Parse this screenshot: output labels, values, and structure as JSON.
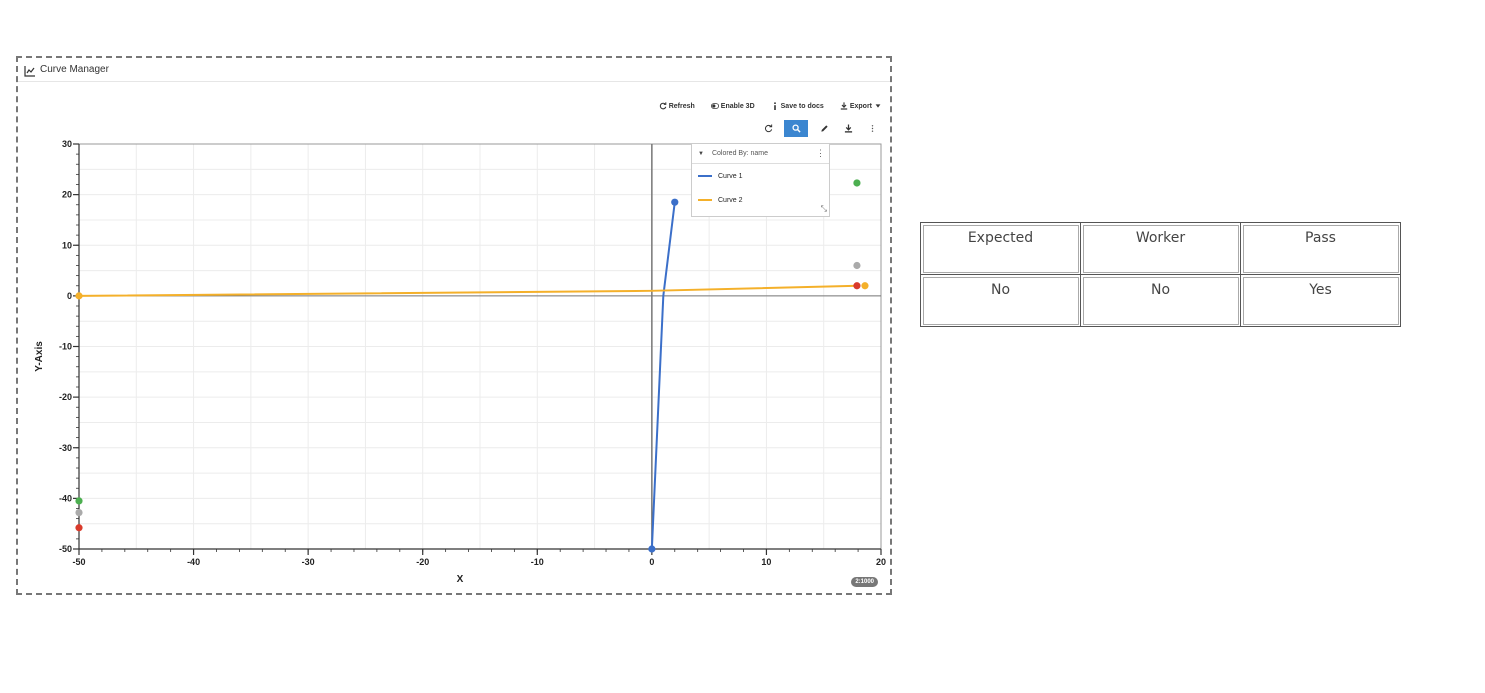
{
  "panel": {
    "title": "Curve Manager"
  },
  "toolbar": {
    "refresh_label": "Refresh",
    "enable3d_label": "Enable 3D",
    "save_label": "Save to docs",
    "export_label": "Export"
  },
  "legend": {
    "header": "Colored By: name",
    "items": [
      {
        "label": "Curve 1",
        "color": "#3b6fc9"
      },
      {
        "label": "Curve 2",
        "color": "#f4b02a"
      }
    ]
  },
  "zoom_badge": "2:1000",
  "chart_data": {
    "type": "line",
    "xlabel": "X",
    "ylabel": "Y-Axis",
    "xlim": [
      -50,
      20
    ],
    "ylim": [
      -50,
      30
    ],
    "xticks": [
      -50,
      -40,
      -30,
      -20,
      -10,
      0,
      10,
      20
    ],
    "yticks": [
      30,
      20,
      10,
      0,
      -10,
      -20,
      -30,
      -40,
      -50
    ],
    "grid": true,
    "legend_position": "top-right",
    "series": [
      {
        "name": "Curve 1",
        "color": "#3b6fc9",
        "x": [
          0,
          1,
          2
        ],
        "y": [
          -50,
          0,
          18.5
        ]
      },
      {
        "name": "Curve 2",
        "color": "#f4b02a",
        "x": [
          -50,
          0,
          18
        ],
        "y": [
          0,
          1,
          2
        ]
      }
    ],
    "markers": [
      {
        "x": 2,
        "y": 18.5,
        "color": "#3b6fc9"
      },
      {
        "x": 0,
        "y": -50,
        "color": "#3b6fc9"
      },
      {
        "x": -50,
        "y": 0,
        "color": "#f4b02a"
      },
      {
        "x": 18.6,
        "y": 2,
        "color": "#f4b02a"
      },
      {
        "x": 17.9,
        "y": 2,
        "color": "#d93a2b"
      },
      {
        "x": 17.9,
        "y": 6,
        "color": "#aaaaaa"
      },
      {
        "x": 17.9,
        "y": 22.3,
        "color": "#4caf50"
      },
      {
        "x": -50,
        "y": -40.5,
        "color": "#4caf50"
      },
      {
        "x": -50,
        "y": -42.8,
        "color": "#aaaaaa"
      },
      {
        "x": -50,
        "y": -45.8,
        "color": "#d93a2b"
      }
    ]
  },
  "table": {
    "headers": [
      "Expected",
      "Worker",
      "Pass"
    ],
    "row": [
      "No",
      "No",
      "Yes"
    ]
  }
}
